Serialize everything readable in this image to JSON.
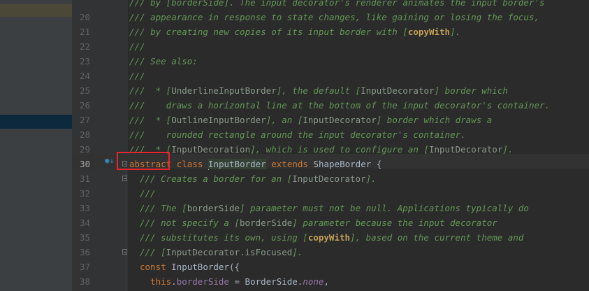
{
  "editor": {
    "lines": [
      {
        "num": "",
        "tokens": [
          {
            "t": "/// by [borderSide]. The input decorator's renderer animates the input border's",
            "c": "doc"
          }
        ]
      },
      {
        "num": "20",
        "tokens": [
          {
            "t": "/// appearance in response to state changes, like gaining or losing the focus,",
            "c": "doc"
          }
        ]
      },
      {
        "num": "21",
        "tokens": [
          {
            "t": "/// by creating new copies of its input border with [",
            "c": "doc"
          },
          {
            "t": "copyWith",
            "c": "tag"
          },
          {
            "t": "].",
            "c": "doc"
          }
        ]
      },
      {
        "num": "22",
        "tokens": [
          {
            "t": "///",
            "c": "doc"
          }
        ]
      },
      {
        "num": "23",
        "tokens": [
          {
            "t": "/// See also:",
            "c": "doc"
          }
        ]
      },
      {
        "num": "24",
        "tokens": [
          {
            "t": "///",
            "c": "doc"
          }
        ]
      },
      {
        "num": "25",
        "tokens": [
          {
            "t": "///  * [",
            "c": "doc"
          },
          {
            "t": "UnderlineInputBorder",
            "c": "ref"
          },
          {
            "t": "], the default [",
            "c": "doc"
          },
          {
            "t": "InputDecorator",
            "c": "ref"
          },
          {
            "t": "] border which",
            "c": "doc"
          }
        ]
      },
      {
        "num": "26",
        "tokens": [
          {
            "t": "///    draws a horizontal line at the bottom of the input decorator's container.",
            "c": "doc"
          }
        ]
      },
      {
        "num": "27",
        "tokens": [
          {
            "t": "///  * [",
            "c": "doc"
          },
          {
            "t": "OutlineInputBorder",
            "c": "ref"
          },
          {
            "t": "], an [",
            "c": "doc"
          },
          {
            "t": "InputDecorator",
            "c": "ref"
          },
          {
            "t": "] border which draws a",
            "c": "doc"
          }
        ]
      },
      {
        "num": "28",
        "tokens": [
          {
            "t": "///    rounded rectangle around the input decorator's container.",
            "c": "doc"
          }
        ]
      },
      {
        "num": "29",
        "tokens": [
          {
            "t": "///  * [",
            "c": "doc"
          },
          {
            "t": "InputDecoration",
            "c": "ref"
          },
          {
            "t": "], which is used to configure an [",
            "c": "doc"
          },
          {
            "t": "InputDecorator",
            "c": "ref"
          },
          {
            "t": "].",
            "c": "doc"
          }
        ]
      },
      {
        "num": "30",
        "tokens": [
          {
            "t": "abstract",
            "c": "kw"
          },
          {
            "t": " ",
            "c": "cls"
          },
          {
            "t": "class",
            "c": "kw"
          },
          {
            "t": " ",
            "c": "cls"
          },
          {
            "t": "InputBorder",
            "c": "cls hl",
            "caret": true
          },
          {
            "t": " ",
            "c": "cls"
          },
          {
            "t": "extends",
            "c": "kw"
          },
          {
            "t": " ShapeBorder {",
            "c": "cls"
          }
        ]
      },
      {
        "num": "31",
        "tokens": [
          {
            "t": "/// Creates a border for an [",
            "c": "doc"
          },
          {
            "t": "InputDecorator",
            "c": "ref"
          },
          {
            "t": "].",
            "c": "doc"
          }
        ]
      },
      {
        "num": "32",
        "tokens": [
          {
            "t": "///",
            "c": "doc"
          }
        ]
      },
      {
        "num": "33",
        "tokens": [
          {
            "t": "/// The [",
            "c": "doc"
          },
          {
            "t": "borderSide",
            "c": "ref"
          },
          {
            "t": "] parameter must not be null. Applications typically do",
            "c": "doc"
          }
        ]
      },
      {
        "num": "34",
        "tokens": [
          {
            "t": "/// not specify a [",
            "c": "doc"
          },
          {
            "t": "borderSide",
            "c": "ref"
          },
          {
            "t": "] parameter because the input decorator",
            "c": "doc"
          }
        ]
      },
      {
        "num": "35",
        "tokens": [
          {
            "t": "/// substitutes its own, using [",
            "c": "doc"
          },
          {
            "t": "copyWith",
            "c": "tag"
          },
          {
            "t": "], based on the current theme and",
            "c": "doc"
          }
        ]
      },
      {
        "num": "36",
        "tokens": [
          {
            "t": "/// [",
            "c": "doc"
          },
          {
            "t": "InputDecorator.isFocused",
            "c": "ref"
          },
          {
            "t": "].",
            "c": "doc"
          }
        ]
      },
      {
        "num": "37",
        "tokens": [
          {
            "t": "const",
            "c": "kw"
          },
          {
            "t": " InputBorder({",
            "c": "cls"
          }
        ]
      },
      {
        "num": "38",
        "tokens": [
          {
            "t": "  ",
            "c": "cls"
          },
          {
            "t": "this",
            "c": "kw"
          },
          {
            "t": ".",
            "c": "cls"
          },
          {
            "t": "borderSide",
            "c": "field"
          },
          {
            "t": " = BorderSide.",
            "c": "cls"
          },
          {
            "t": "none",
            "c": "it"
          },
          {
            "t": ",",
            "c": "cls"
          }
        ]
      }
    ],
    "current_line": "30",
    "indented_from": 12,
    "fold_lines": [
      "30",
      "31",
      "36"
    ]
  },
  "colors": {
    "background": "#2b2b2b",
    "gutter": "#313335",
    "doc_comment": "#629755",
    "keyword": "#cc7832",
    "highlight_box": "#e8242c"
  },
  "icons": [
    "override-icon",
    "fold-icon"
  ]
}
